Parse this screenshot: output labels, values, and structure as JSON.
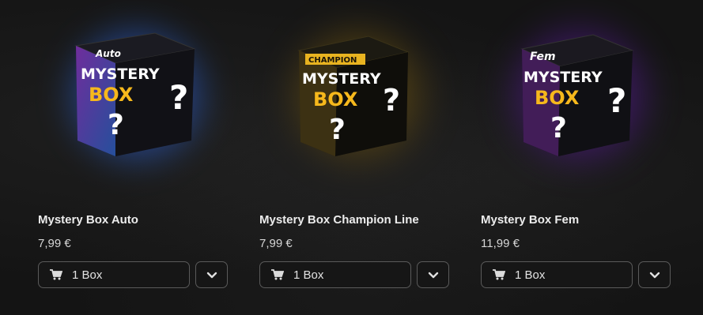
{
  "products": [
    {
      "name": "Mystery Box Auto",
      "price": "7,99 €",
      "quantity_option": "1 Box",
      "box_art": {
        "top_word": "Auto",
        "main_line1": "MYSTERY",
        "main_line2": "BOX",
        "accent": "#b43dff",
        "accent2": "#2f7bff"
      }
    },
    {
      "name": "Mystery Box Champion Line",
      "price": "7,99 €",
      "quantity_option": "1 Box",
      "box_art": {
        "top_word": "CHAMPION",
        "main_line1": "MYSTERY",
        "main_line2": "BOX",
        "accent": "#e8b320",
        "accent2": "#f5d36a"
      }
    },
    {
      "name": "Mystery Box Fem",
      "price": "11,99 €",
      "quantity_option": "1 Box",
      "box_art": {
        "top_word": "Fem",
        "main_line1": "MYSTERY",
        "main_line2": "BOX",
        "accent": "#a62fe0",
        "accent2": "#d04ef0"
      }
    }
  ],
  "icons": {
    "cart": "cart-icon",
    "dropdown": "chevron-down-icon"
  }
}
